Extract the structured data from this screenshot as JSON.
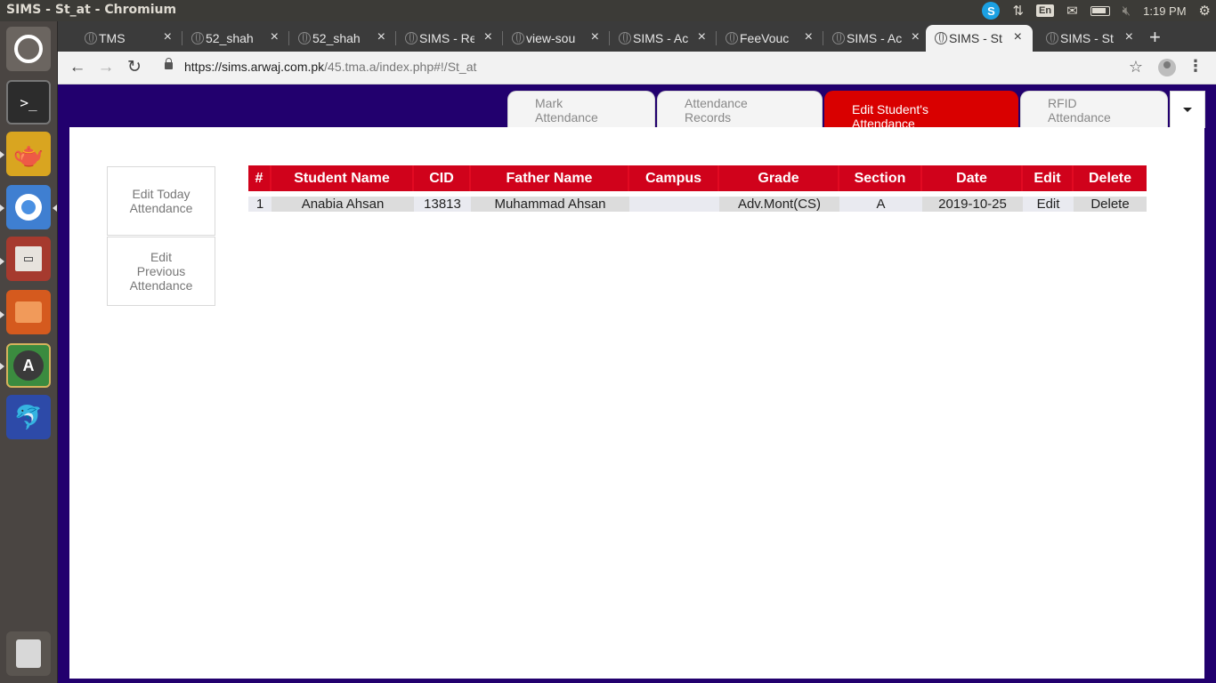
{
  "window": {
    "title": "SIMS - St_at - Chromium"
  },
  "tray": {
    "keyboard": "En",
    "time": "1:19 PM"
  },
  "browser": {
    "tabs": [
      {
        "label": "TMS",
        "active": false
      },
      {
        "label": "52_shah",
        "active": false
      },
      {
        "label": "52_shah",
        "active": false
      },
      {
        "label": "SIMS - Re",
        "active": false
      },
      {
        "label": "view-sou",
        "active": false
      },
      {
        "label": "SIMS - Ac",
        "active": false
      },
      {
        "label": "FeeVouc",
        "active": false
      },
      {
        "label": "SIMS - Ac",
        "active": false
      },
      {
        "label": "SIMS - St",
        "active": true
      },
      {
        "label": "SIMS - St",
        "active": false
      }
    ],
    "url_host": "https://sims.arwaj.com.pk",
    "url_path": "/45.tma.a/index.php#!/St_at"
  },
  "page_tabs": {
    "mark": "Mark Attendance",
    "records": "Attendance Records",
    "edit": "Edit Student's Attendance",
    "rfid": "RFID Attendance"
  },
  "side_menu": {
    "today": "Edit Today Attendance",
    "previous": "Edit Previous Attendance"
  },
  "table": {
    "headers": [
      "#",
      "Student Name",
      "CID",
      "Father Name",
      "Campus",
      "Grade",
      "Section",
      "Date",
      "Edit",
      "Delete"
    ],
    "rows": [
      {
        "num": "1",
        "student": "Anabia Ahsan",
        "cid": "13813",
        "father": "Muhammad Ahsan",
        "campus": "",
        "grade": "Adv.Mont(CS)",
        "section": "A",
        "date": "2019-10-25",
        "edit": "Edit",
        "delete": "Delete"
      }
    ]
  }
}
